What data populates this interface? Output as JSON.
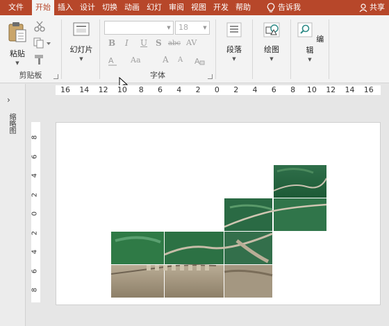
{
  "tabs": [
    {
      "label": "文件",
      "active": false
    },
    {
      "label": "开始",
      "active": true
    },
    {
      "label": "插入",
      "active": false
    },
    {
      "label": "设计",
      "active": false
    },
    {
      "label": "切换",
      "active": false
    },
    {
      "label": "动画",
      "active": false
    },
    {
      "label": "幻灯",
      "active": false
    },
    {
      "label": "审阅",
      "active": false
    },
    {
      "label": "视图",
      "active": false
    },
    {
      "label": "开发",
      "active": false
    },
    {
      "label": "帮助",
      "active": false
    }
  ],
  "tell_me": "告诉我",
  "share": "共享",
  "ribbon": {
    "clipboard": {
      "paste_label": "粘贴",
      "group_label": "剪贴板"
    },
    "slides": {
      "new_slide_label": "幻灯片"
    },
    "font": {
      "font_name": "",
      "font_size": "18",
      "group_label": "字体",
      "bold": "B",
      "italic": "I",
      "underline": "U",
      "shadow": "S",
      "strike": "abc",
      "spacing": "AV",
      "case": "Aa",
      "grow": "A",
      "shrink": "A"
    },
    "paragraph": {
      "label": "段落"
    },
    "drawing": {
      "label": "绘图"
    },
    "editing": {
      "label": "编辑"
    }
  },
  "thumbnail_pane": {
    "label": "缩略图"
  },
  "ruler_h": [
    "16",
    "14",
    "12",
    "10",
    "8",
    "6",
    "4",
    "2",
    "0",
    "2",
    "4",
    "6",
    "8",
    "10",
    "12",
    "14",
    "16"
  ],
  "ruler_v": [
    "8",
    "6",
    "4",
    "2",
    "0",
    "2",
    "4",
    "6",
    "8"
  ],
  "colors": {
    "accent": "#b7472a",
    "ribbon_bg": "#f3f3f3",
    "workspace": "#e6e6e6"
  }
}
